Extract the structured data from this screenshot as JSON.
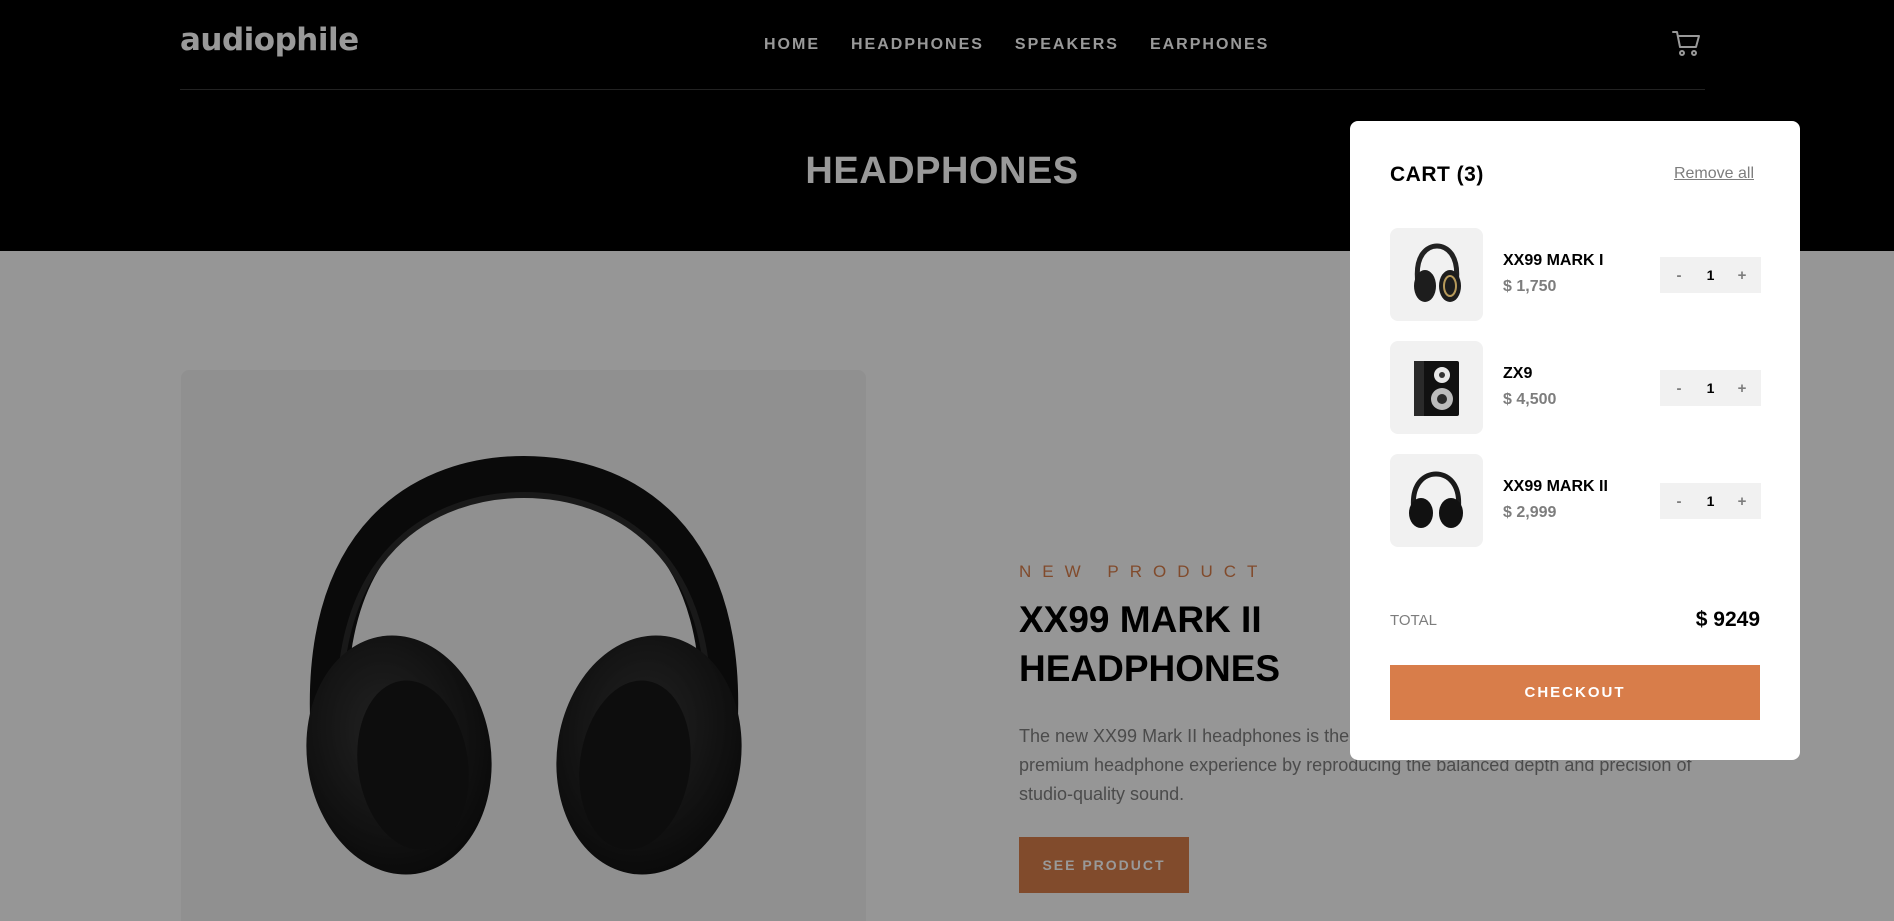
{
  "header": {
    "logo": "audiophile",
    "nav": [
      "HOME",
      "HEADPHONES",
      "SPEAKERS",
      "EARPHONES"
    ],
    "cart_icon": "cart-icon",
    "category_title": "HEADPHONES"
  },
  "product": {
    "overline": "NEW PRODUCT",
    "name": "XX99 MARK II HEADPHONES",
    "description": "The new XX99 Mark II headphones is the pinnacle of pristine audio. It redefines your premium headphone experience by reproducing the balanced depth and precision of studio-quality sound.",
    "button": "SEE PRODUCT"
  },
  "cart": {
    "title": "CART (3)",
    "remove_all": "Remove all",
    "items": [
      {
        "name": "XX99 MARK I",
        "price": "$ 1,750",
        "qty": "1",
        "minus": "-",
        "plus": "+"
      },
      {
        "name": "ZX9",
        "price": "$ 4,500",
        "qty": "1",
        "minus": "-",
        "plus": "+"
      },
      {
        "name": "XX99 MARK II",
        "price": "$ 2,999",
        "qty": "1",
        "minus": "-",
        "plus": "+"
      }
    ],
    "total_label": "TOTAL",
    "total_value": "$ 9249",
    "checkout": "CHECKOUT"
  },
  "colors": {
    "accent": "#d87d4a",
    "dark": "#000000",
    "light_bg": "#f1f1f1"
  }
}
